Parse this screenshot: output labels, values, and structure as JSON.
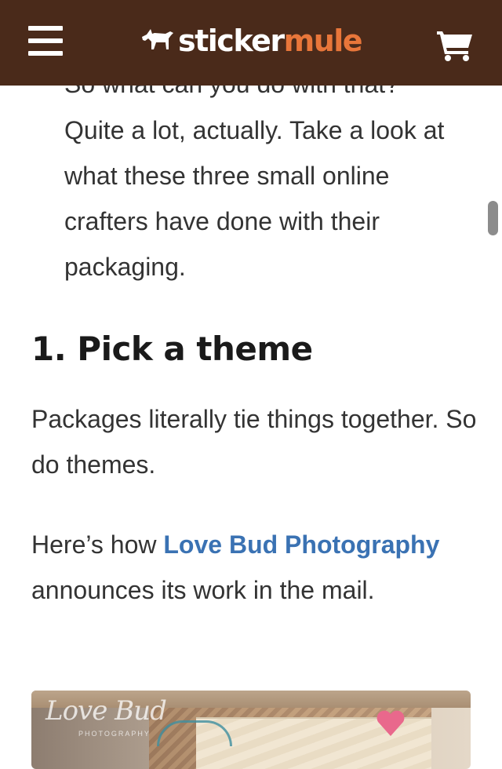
{
  "header": {
    "logo_part1": "sticker",
    "logo_part2": "mule",
    "menu_icon": "hamburger-menu-icon",
    "cart_icon": "shopping-cart-icon",
    "background_color": "#4a2a1a",
    "accent_color": "#e8763a"
  },
  "article": {
    "cut_off_line": "So what can you do with that?",
    "intro_text": "Quite a lot, actually. Take a look at what these three small online crafters have done with their packaging.",
    "section_heading": "1. Pick a theme",
    "paragraph1": "Packages literally tie things together. So do themes.",
    "paragraph2_before": "Here’s how ",
    "paragraph2_link": "Love Bud Photography",
    "paragraph2_after": " announces its work in the mail.",
    "link_color": "#3a72b3"
  },
  "image": {
    "watermark_script": "Love Bud",
    "watermark_sub": "PHOTOGRAPHY"
  }
}
